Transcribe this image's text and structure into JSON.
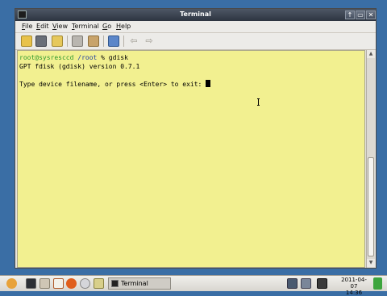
{
  "window": {
    "title": "Terminal",
    "buttons": [
      "↑",
      "▭",
      "✕"
    ]
  },
  "menubar": {
    "items": [
      {
        "accel": "F",
        "rest": "ile"
      },
      {
        "accel": "E",
        "rest": "dit"
      },
      {
        "accel": "V",
        "rest": "iew"
      },
      {
        "accel": "T",
        "rest": "erminal"
      },
      {
        "accel": "G",
        "rest": "o"
      },
      {
        "accel": "H",
        "rest": "elp"
      }
    ]
  },
  "toolbar": {
    "icons": [
      "new-tab-icon",
      "close-tab-icon",
      "new-window-icon",
      "copy-icon",
      "paste-icon",
      "zoom-icon",
      "back-icon",
      "forward-icon"
    ]
  },
  "terminal": {
    "line1": {
      "user": "root@sysresccd",
      "path": "/root",
      "rest": " % gdisk"
    },
    "line2": "GPT fdisk (gdisk) version 0.7.1",
    "line3": "",
    "line4": "Type device filename, or press <Enter> to exit: "
  },
  "taskbar": {
    "task_label": "Terminal",
    "date": "2011-04-07",
    "time": "14:36"
  },
  "colors": {
    "terminal_bg": "#f2f090",
    "prompt_user": "#2f9a2f",
    "prompt_path": "#1e3ea3",
    "desktop": "#3a6ea5"
  }
}
